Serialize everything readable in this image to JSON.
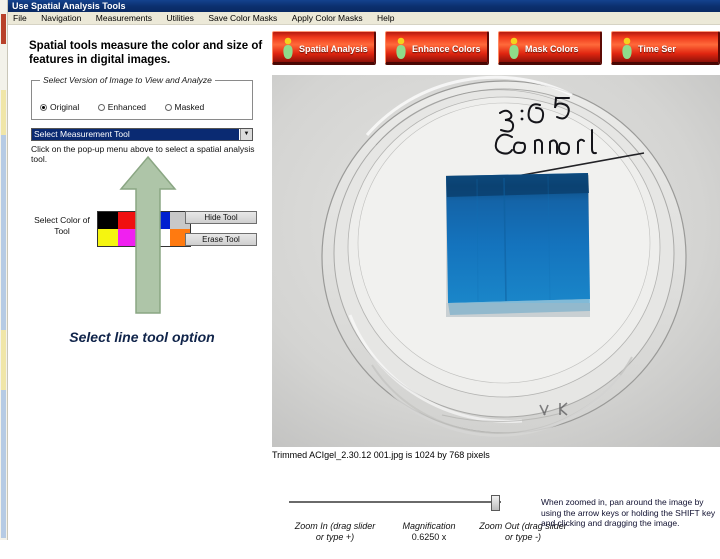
{
  "window": {
    "title": "Use Spatial Analysis Tools"
  },
  "menubar": {
    "items": [
      {
        "label": "File"
      },
      {
        "label": "Navigation"
      },
      {
        "label": "Measurements"
      },
      {
        "label": "Utilities"
      },
      {
        "label": "Save Color Masks"
      },
      {
        "label": "Apply Color Masks"
      },
      {
        "label": "Help"
      }
    ]
  },
  "panel": {
    "heading": "Spatial tools measure the color and size of features in digital images.",
    "version_group": {
      "title": "Select Version of Image to View and Analyze",
      "options": [
        {
          "label": "Original",
          "selected": true
        },
        {
          "label": "Enhanced",
          "selected": false
        },
        {
          "label": "Masked",
          "selected": false
        }
      ]
    },
    "measurement_combo": {
      "value": "Select Measurement Tool",
      "arrow": "chevron-down-icon"
    },
    "combo_hint": "Click on the pop-up menu above to select a spatial analysis tool.",
    "color_label": "Select Color of Tool",
    "swatches_left": [
      "#000000",
      "#f01010",
      "#f5f510",
      "#f020f0"
    ],
    "swatches_right": [
      "#0020d0",
      "#c8c8c8",
      "#ffffff",
      "#ff7a10"
    ],
    "buttons": {
      "hide": "Hide Tool",
      "erase": "Erase Tool"
    },
    "callout": "Select line tool option"
  },
  "toolbar": {
    "buttons": [
      {
        "label": "Spatial Analysis"
      },
      {
        "label": "Enhance Colors"
      },
      {
        "label": "Mask Colors"
      },
      {
        "label": "Time Ser"
      }
    ],
    "accent_color": "#e02510"
  },
  "photo": {
    "handwriting_line1": "3:05",
    "handwriting_line2": "Control",
    "gel_color": "#1668b8",
    "alt": "petri-dish-with-blue-gel"
  },
  "caption": "Trimmed ACIgel_2.30.12 001.jpg is 1024 by 768 pixels",
  "zoom": {
    "zoom_in": "Zoom In (drag slider or type +)",
    "zoom_out": "Zoom Out (drag slider or type -)",
    "magnification_label": "Magnification",
    "magnification_value": "0.6250 x",
    "slider_position_percent": 95
  },
  "note": "When zoomed in, pan around the image by using the arrow keys or holding the SHIFT key and clicking and dragging the image."
}
